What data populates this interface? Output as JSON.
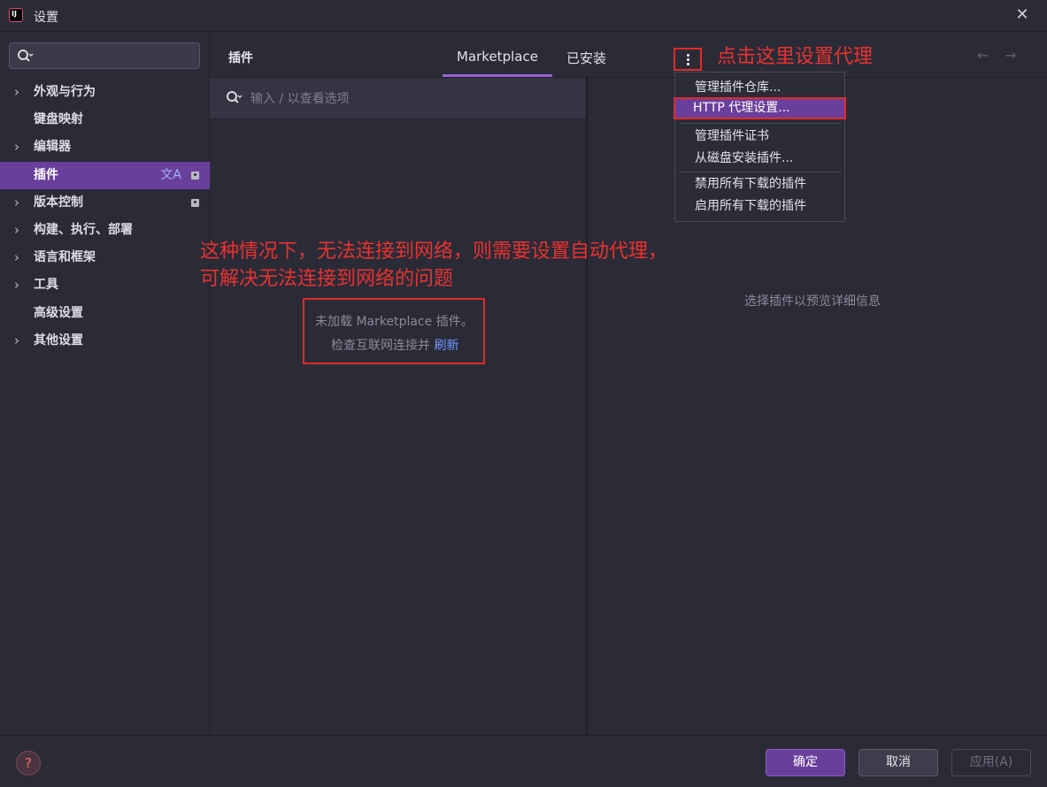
{
  "window": {
    "title": "设置"
  },
  "sidebar": {
    "search_placeholder": "",
    "items": [
      {
        "label": "外观与行为",
        "expandable": true
      },
      {
        "label": "键盘映射",
        "expandable": false
      },
      {
        "label": "编辑器",
        "expandable": true
      },
      {
        "label": "插件",
        "expandable": false,
        "active": true
      },
      {
        "label": "版本控制",
        "expandable": true
      },
      {
        "label": "构建、执行、部署",
        "expandable": true
      },
      {
        "label": "语言和框架",
        "expandable": true
      },
      {
        "label": "工具",
        "expandable": true
      },
      {
        "label": "高级设置",
        "expandable": false
      },
      {
        "label": "其他设置",
        "expandable": true
      }
    ]
  },
  "header": {
    "section_title": "插件",
    "tabs": [
      {
        "label": "Marketplace",
        "active": true
      },
      {
        "label": "已安装",
        "active": false
      }
    ]
  },
  "plugin_search": {
    "placeholder": "输入 / 以查看选项"
  },
  "menu": {
    "items": [
      {
        "label": "管理插件仓库..."
      },
      {
        "label": "HTTP 代理设置...",
        "highlighted": true
      },
      {
        "label": "管理插件证书"
      },
      {
        "label": "从磁盘安装插件..."
      },
      {
        "label": "禁用所有下载的插件"
      },
      {
        "label": "启用所有下载的插件"
      }
    ]
  },
  "message": {
    "line1": "未加载 Marketplace 插件。",
    "line2_prefix": "检查互联网连接并",
    "line2_link": "刷新"
  },
  "detail_hint": "选择插件以预览详细信息",
  "annotations": {
    "menu_hint": "点击这里设置代理",
    "explain_line1": "这种情况下，无法连接到网络，则需要设置自动代理，",
    "explain_line2": "可解决无法连接到网络的问题"
  },
  "footer": {
    "help": "?",
    "ok": "确定",
    "cancel": "取消",
    "apply": "应用(A)"
  },
  "colors": {
    "accent": "#6a3f9c",
    "annotation_red": "#e8322e",
    "link_blue": "#6f9bff"
  }
}
